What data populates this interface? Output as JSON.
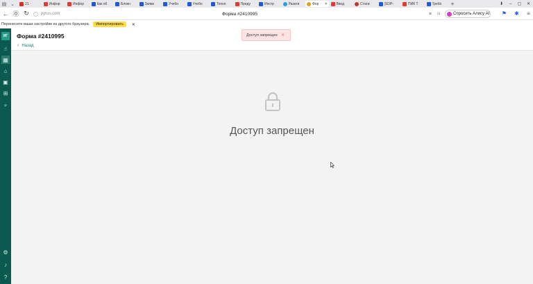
{
  "tabs": [
    {
      "label": "21 ·",
      "icon": "gmail-icon",
      "color": "#d93025",
      "active": false
    },
    {
      "label": "Инфор",
      "icon": "yandex-icon",
      "color": "#e53935",
      "active": false
    },
    {
      "label": "Инфор",
      "icon": "yandex-icon",
      "color": "#e53935",
      "active": false
    },
    {
      "label": "Как об",
      "icon": "tracker-icon",
      "color": "#1e5bd8",
      "active": false
    },
    {
      "label": "Блокн",
      "icon": "tracker-icon",
      "color": "#1e5bd8",
      "active": false
    },
    {
      "label": "Заявк",
      "icon": "tracker-icon",
      "color": "#1e5bd8",
      "active": false
    },
    {
      "label": "Учебн",
      "icon": "tracker-icon",
      "color": "#1e5bd8",
      "active": false
    },
    {
      "label": "Учебн",
      "icon": "tracker-icon",
      "color": "#1e5bd8",
      "active": false
    },
    {
      "label": "Техно",
      "icon": "tracker-icon",
      "color": "#1e5bd8",
      "active": false
    },
    {
      "label": "Преду",
      "icon": "yandex-icon",
      "color": "#e53935",
      "active": false
    },
    {
      "label": "Инстр",
      "icon": "doc-icon",
      "color": "#1e5bd8",
      "active": false
    },
    {
      "label": "Разати",
      "icon": "telegram-icon",
      "color": "#2aa0da",
      "active": false
    },
    {
      "label": "Фор",
      "icon": "bulb-icon",
      "color": "#e3a21a",
      "active": true
    },
    {
      "label": "Ввод",
      "icon": "yandex-icon",
      "color": "#e53935",
      "active": false
    },
    {
      "label": "Стати",
      "icon": "opera-icon",
      "color": "#c0392b",
      "active": false
    },
    {
      "label": "[SDP-",
      "icon": "jira-icon",
      "color": "#1e5bd8",
      "active": false
    },
    {
      "label": "ПИК Т",
      "icon": "yandex-icon",
      "color": "#e53935",
      "active": false
    },
    {
      "label": "Требо",
      "icon": "tracker-icon",
      "color": "#1e5bd8",
      "active": false
    }
  ],
  "address": {
    "site": "pyrus.com",
    "page_title": "Форма #2410995"
  },
  "alice": {
    "label": "Спросить Алису AI"
  },
  "import_bar": {
    "message": "Перенесите ваши настройки из другого браузера.",
    "button": "Импортировать"
  },
  "sidebar": {
    "logo": "ИГ"
  },
  "page": {
    "title": "Форма #2410995",
    "back": "Назад"
  },
  "toast": {
    "message": "Доступ запрещен"
  },
  "main": {
    "message": "Доступ запрещен"
  },
  "colors": {
    "sidebar": "#0b5a50",
    "accent": "#1e7e6e",
    "toast_bg": "#fce4e4",
    "import_button": "#ffdb4d"
  }
}
